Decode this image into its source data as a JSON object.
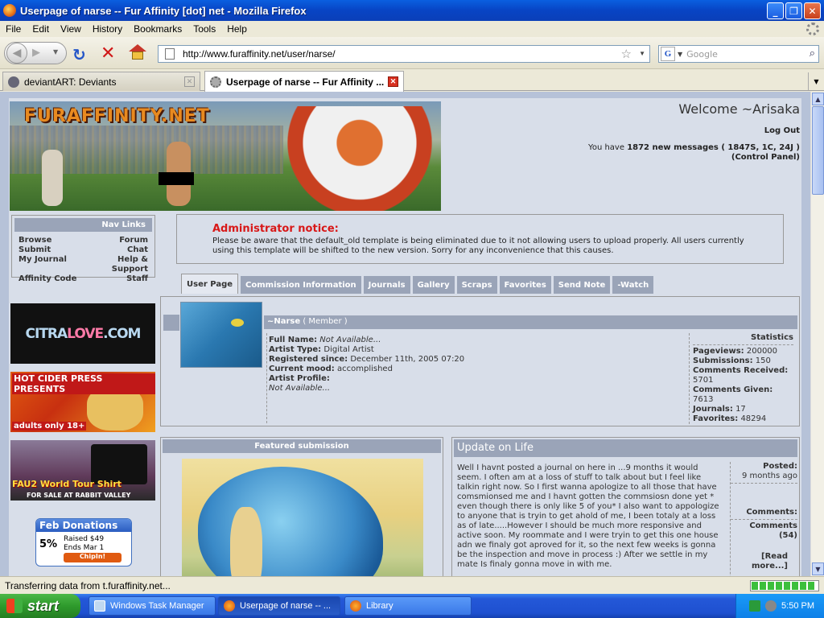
{
  "window": {
    "title": "Userpage of narse -- Fur Affinity [dot] net - Mozilla Firefox"
  },
  "menu": [
    "File",
    "Edit",
    "View",
    "History",
    "Bookmarks",
    "Tools",
    "Help"
  ],
  "toolbar": {
    "url": "http://www.furaffinity.net/user/narse/",
    "search_placeholder": "Google"
  },
  "tabs": [
    {
      "label": "deviantART: Deviants"
    },
    {
      "label": "Userpage of narse -- Fur Affinity ..."
    }
  ],
  "header": {
    "logo": "FURAFFINITY.NET",
    "welcome": "Welcome ~Arisaka",
    "logout": "Log Out",
    "messages_pre": "You have ",
    "messages_count": "1872 new messages",
    "messages_detail": " ( 1847S, 1C, 24J )",
    "control_panel": "(Control Panel)"
  },
  "nav": {
    "title": "Nav Links",
    "links": [
      "Browse",
      "Forum",
      "Submit",
      "Chat",
      "My Journal",
      "Help & Support",
      "Affinity Code",
      "Staff"
    ]
  },
  "ads": {
    "citra_a": "CITRA",
    "citra_b": "LOVE",
    "citra_c": ".COM",
    "cider_title": "HOT CIDER PRESS PRESENTS",
    "cider_sub": "adults only 18+",
    "shirt_title": "FAU2 World Tour Shirt",
    "shirt_sub": "FOR SALE AT RABBIT VALLEY"
  },
  "donations": {
    "title": "Feb Donations",
    "percent": "5%",
    "raised": "Raised $49",
    "ends": "Ends Mar 1",
    "chip": "ChipIn!"
  },
  "notice": {
    "title": "Administrator notice:",
    "body": "Please be aware that the default_old template is being eliminated due to it not allowing users to upload properly. All users currently using this template will be shifted to the new version. Sorry for any inconvenience that this causes."
  },
  "profile_tabs": [
    "User Page",
    "Commission Information",
    "Journals",
    "Gallery",
    "Scraps",
    "Favorites",
    "Send Note",
    "-Watch"
  ],
  "profile": {
    "name": "~Narse",
    "role": " ( Member )",
    "fields": [
      {
        "label": "Full Name:",
        "value": " Not Available..."
      },
      {
        "label": "Artist Type:",
        "value": " Digital Artist"
      },
      {
        "label": "Registered since:",
        "value": " December 11th, 2005 07:20"
      },
      {
        "label": "Current mood:",
        "value": " accomplished"
      },
      {
        "label": "Artist Profile:",
        "value": ""
      }
    ],
    "artist_profile_value": "Not Available..."
  },
  "stats": {
    "title": "Statistics",
    "rows": [
      {
        "label": "Pageviews:",
        "value": " 200000"
      },
      {
        "label": "Submissions:",
        "value": " 150"
      },
      {
        "label": "Comments Received:",
        "value": " 5701"
      },
      {
        "label": "Comments Given:",
        "value": " 7613"
      },
      {
        "label": "Journals:",
        "value": " 17"
      },
      {
        "label": "Favorites:",
        "value": " 48294"
      }
    ]
  },
  "featured": {
    "title": "Featured submission"
  },
  "journal": {
    "title": "Update on Life",
    "body": "Well I havnt posted a journal on here in ...9 months it would seem. I often am at a loss of stuff to talk about but I feel like talkin right now. So I first wanna apologize to all those that have comsmionsed me and I havnt gotten the commsiosn done yet * even though there is only like 5 of you* I also want to appologize to anyone that is tryin to get ahold of me, I been totaly at a loss as of late.....However I should be much more responsive and active soon. My roommate and I were tryin to get this one house adn we finaly got aproved for it, so the next few weeks is gonna be the inspection and move in process :) After we settle in my mate Is finaly gonna move in with me.",
    "posted_label": "Posted:",
    "posted_value": "9 months ago",
    "comments_label": "Comments:",
    "comments_link": "Comments (54)",
    "read_more": "[Read more...]"
  },
  "status": {
    "text": "Transferring data from t.furaffinity.net..."
  },
  "taskbar": {
    "start": "start",
    "items": [
      "Windows Task Manager",
      "Userpage of narse -- ...",
      "Library"
    ],
    "clock": "5:50 PM"
  }
}
